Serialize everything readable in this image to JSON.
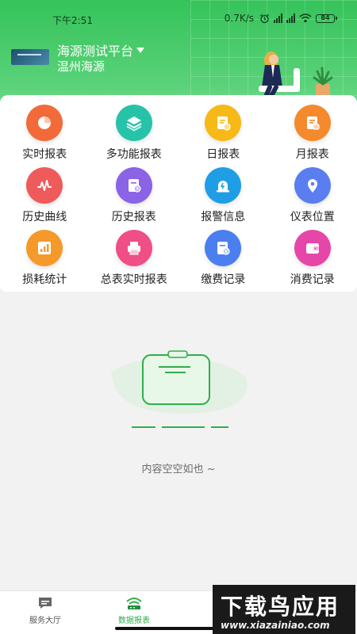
{
  "status_bar": {
    "time": "下午2:51",
    "speed": "0.7K/s",
    "battery": "84"
  },
  "header": {
    "platform_name": "海源测试平台",
    "org_name": "温州海源"
  },
  "grid": {
    "items": [
      {
        "label": "实时报表",
        "icon": "pie-chart-icon",
        "color": "#f26a3a"
      },
      {
        "label": "多功能报表",
        "icon": "layers-icon",
        "color": "#27c3a9"
      },
      {
        "label": "日报表",
        "icon": "daily-report-icon",
        "color": "#f7b917"
      },
      {
        "label": "月报表",
        "icon": "monthly-report-icon",
        "color": "#f58a2c"
      },
      {
        "label": "历史曲线",
        "icon": "curve-icon",
        "color": "#ef5a5a"
      },
      {
        "label": "历史报表",
        "icon": "history-report-icon",
        "color": "#8a63e6"
      },
      {
        "label": "报警信息",
        "icon": "alarm-icon",
        "color": "#1f9ee6"
      },
      {
        "label": "仪表位置",
        "icon": "location-pin-icon",
        "color": "#5a7ef0"
      },
      {
        "label": "损耗统计",
        "icon": "bar-stats-icon",
        "color": "#f59a2a"
      },
      {
        "label": "总表实时报表",
        "icon": "printer-icon",
        "color": "#ef4f86"
      },
      {
        "label": "缴费记录",
        "icon": "payment-record-icon",
        "color": "#4b7ff0"
      },
      {
        "label": "消费记录",
        "icon": "wallet-icon",
        "color": "#e646a8"
      }
    ]
  },
  "empty_state": {
    "message": "内容空空如也 ~"
  },
  "bottom_nav": {
    "service_label": "服务大厅",
    "data_label": "数据报表",
    "active_color": "#2fae4c"
  },
  "watermark": {
    "main": "下载鸟应用",
    "sub": "www.xiazainiao.com"
  }
}
